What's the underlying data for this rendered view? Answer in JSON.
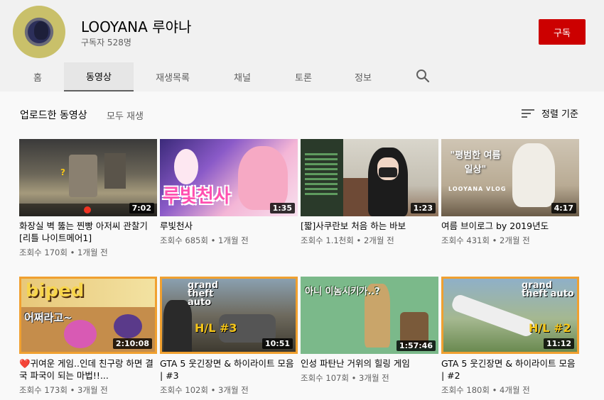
{
  "channel": {
    "name": "LOOYANA 루야나",
    "subscribers": "구독자 528명",
    "subscribe_label": "구독"
  },
  "tabs": [
    {
      "label": "홈"
    },
    {
      "label": "동영상"
    },
    {
      "label": "재생목록"
    },
    {
      "label": "채널"
    },
    {
      "label": "토론"
    },
    {
      "label": "정보"
    }
  ],
  "search_icon": "search-icon",
  "section": {
    "title": "업로드한 동영상",
    "play_all": "모두 재생",
    "sort_label": "정렬 기준"
  },
  "videos": [
    {
      "title": "화장실 벽 뚫는 찐빵 아저씨 관찰기 [리틀 나이트메어1]",
      "views": "조회수 170회",
      "age": "1개월 전",
      "duration": "7:02"
    },
    {
      "title": "루빛천사",
      "views": "조회수 685회",
      "age": "1개월 전",
      "duration": "1:35",
      "thumb_text": "루빛천사"
    },
    {
      "title": "[짧]사쿠란보 처음 하는 바보",
      "views": "조회수 1.1천회",
      "age": "2개월 전",
      "duration": "1:23"
    },
    {
      "title": "여름 브이로그 by 2019년도",
      "views": "조회수 431회",
      "age": "2개월 전",
      "duration": "4:17",
      "thumb_text": "\"평범한 여름 일상\"",
      "thumb_sub": "LOOYANA VLOG"
    },
    {
      "title": "❤️귀여운 게임..인데 친구랑 하면 결국 파국이 되는 마법!!...",
      "views": "조회수 173회",
      "age": "3개월 전",
      "duration": "2:10:08",
      "thumb_text": "biped",
      "thumb_sub": "어쩌라고~"
    },
    {
      "title": "GTA 5 웃긴장면 & 하이라이트 모음 | #3",
      "views": "조회수 102회",
      "age": "3개월 전",
      "duration": "10:51",
      "thumb_text": "grand theft auto",
      "thumb_sub": "H/L #3"
    },
    {
      "title": "인성 파탄난 거위의 힐링 게임",
      "views": "조회수 107회",
      "age": "3개월 전",
      "duration": "1:57:46",
      "thumb_text": "아니 이놈시키가..?"
    },
    {
      "title": "GTA 5 웃긴장면 & 하이라이트 모음 | #2",
      "views": "조회수 180회",
      "age": "4개월 전",
      "duration": "11:12",
      "thumb_text": "grand theft auto",
      "thumb_sub": "H/L #2"
    }
  ],
  "colors": {
    "subscribe_red": "#cc0000",
    "header_bg": "#f1f1f1",
    "page_bg": "#f9f9f9",
    "orange_border": "#f0a030"
  }
}
